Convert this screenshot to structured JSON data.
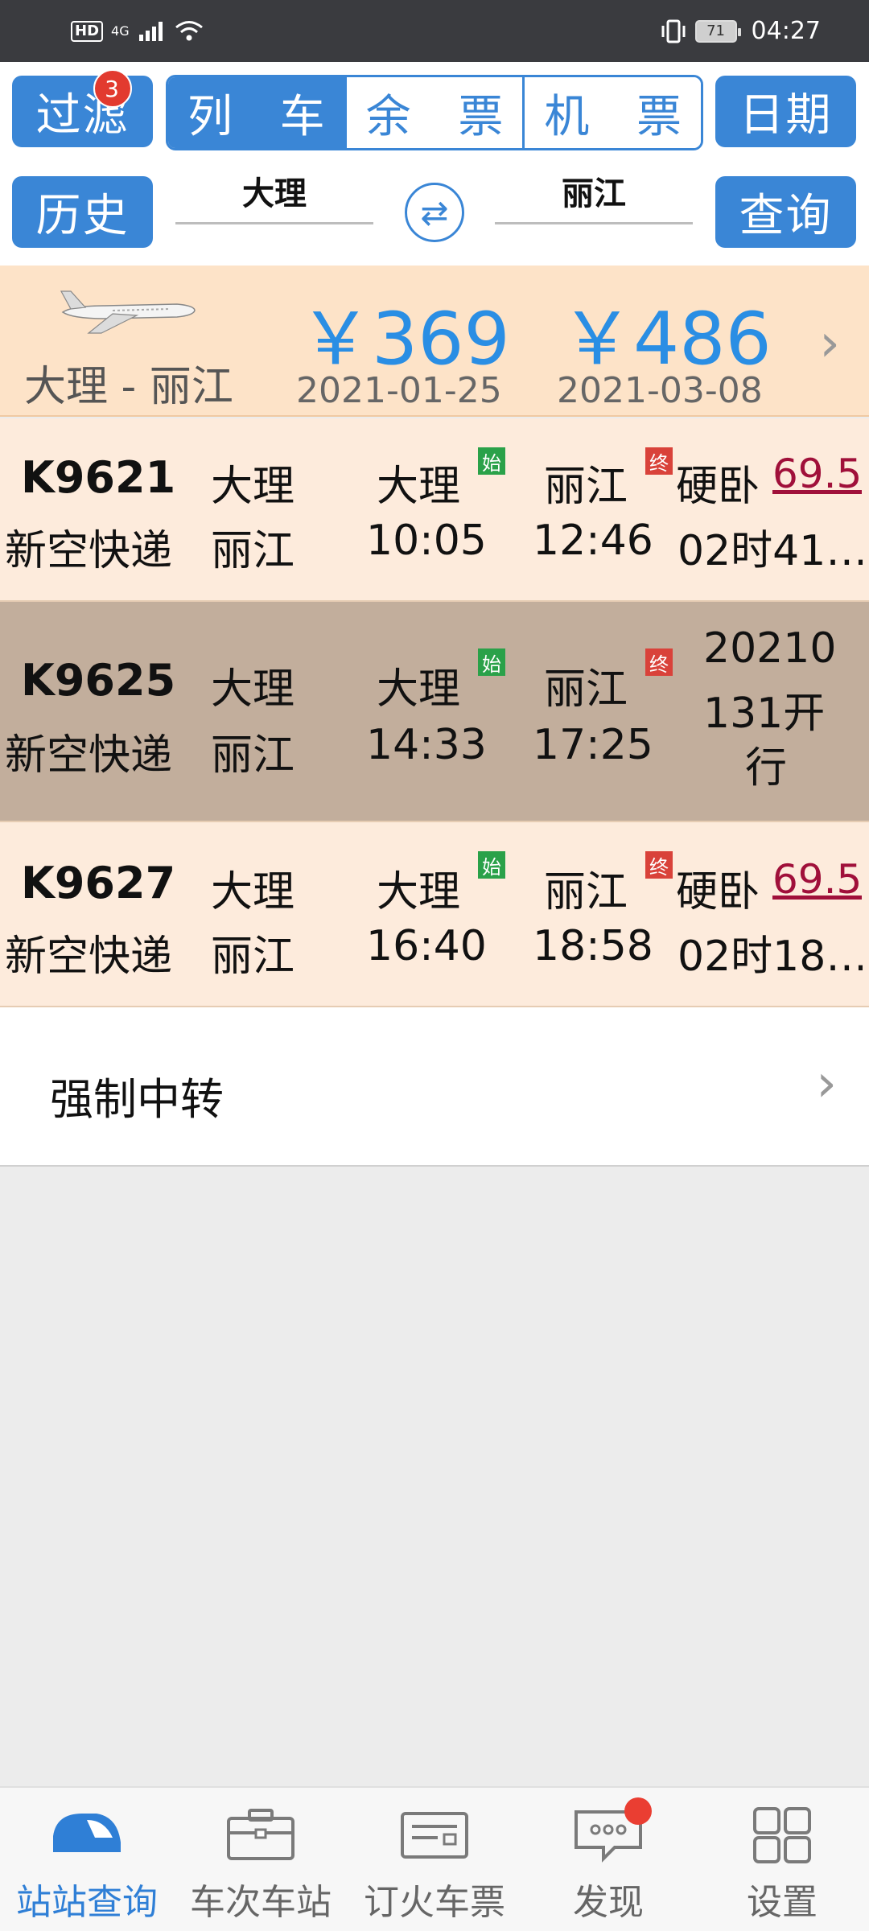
{
  "status_bar": {
    "hd": "HD",
    "network": "4G",
    "battery": "71",
    "time": "04:27"
  },
  "controls": {
    "filter_label": "过滤",
    "filter_badge": "3",
    "segments": [
      {
        "label": [
          "列",
          "车"
        ],
        "active": true
      },
      {
        "label": [
          "余",
          "票"
        ],
        "active": false
      },
      {
        "label": [
          "机",
          "票"
        ],
        "active": false
      }
    ],
    "date_label": "日期",
    "history_label": "历史",
    "from_station": "大理",
    "to_station": "丽江",
    "search_label": "查询"
  },
  "flight": {
    "route": "大理 - 丽江",
    "prices": [
      {
        "price": "￥369",
        "date": "2021-01-25"
      },
      {
        "price": "￥486",
        "date": "2021-03-08"
      }
    ]
  },
  "trains": [
    {
      "code": "K9621",
      "company": "新空快递",
      "from": "大理",
      "to": "丽江",
      "dep_station": "大理",
      "dep_time": "10:05",
      "arr_station": "丽江",
      "arr_time": "12:46",
      "start_tag": "始",
      "end_tag": "终",
      "seat": "硬卧",
      "fare": "69.5",
      "duration": "02时41…",
      "note": ""
    },
    {
      "code": "K9625",
      "company": "新空快递",
      "from": "大理",
      "to": "丽江",
      "dep_station": "大理",
      "dep_time": "14:33",
      "arr_station": "丽江",
      "arr_time": "17:25",
      "start_tag": "始",
      "end_tag": "终",
      "seat": "",
      "fare": "",
      "duration": "",
      "note_lines": [
        "20210",
        "131开",
        "行"
      ]
    },
    {
      "code": "K9627",
      "company": "新空快递",
      "from": "大理",
      "to": "丽江",
      "dep_station": "大理",
      "dep_time": "16:40",
      "arr_station": "丽江",
      "arr_time": "18:58",
      "start_tag": "始",
      "end_tag": "终",
      "seat": "硬卧",
      "fare": "69.5",
      "duration": "02时18…",
      "note": ""
    }
  ],
  "transfer_label": "强制中转",
  "bottom_nav": [
    {
      "label": "站站查询",
      "icon": "train-icon",
      "active": true
    },
    {
      "label": "车次车站",
      "icon": "briefcase-icon",
      "active": false
    },
    {
      "label": "订火车票",
      "icon": "ticket-icon",
      "active": false
    },
    {
      "label": "发现",
      "icon": "chat-icon",
      "active": false,
      "dot": true
    },
    {
      "label": "设置",
      "icon": "grid-icon",
      "active": false
    }
  ]
}
